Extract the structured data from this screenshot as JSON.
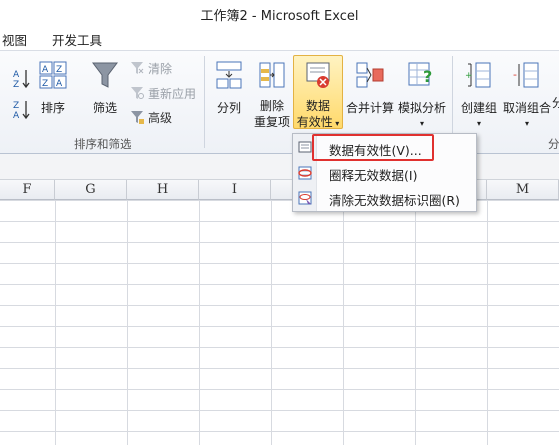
{
  "window": {
    "title": "工作簿2  -  Microsoft Excel"
  },
  "tabs": [
    {
      "label": "视图"
    },
    {
      "label": "开发工具"
    }
  ],
  "ribbon": {
    "sort_filter_group": {
      "label": "排序和筛选",
      "sort_asc_icon": "sort-ascending-icon",
      "sort_desc_icon": "sort-descending-icon",
      "sort_label": "排序",
      "filter_label": "筛选",
      "clear_label": "清除",
      "reapply_label": "重新应用",
      "advanced_label": "高级"
    },
    "data_tools": {
      "split_label": "分列",
      "remove_dup_line1": "删除",
      "remove_dup_line2": "重复项",
      "validation_line1": "数据",
      "validation_line2": "有效性",
      "consolidate_label": "合并计算",
      "whatif_label": "模拟分析"
    },
    "outline": {
      "group_label": "创建组",
      "ungroup_label": "取消组合",
      "partial_label": "分",
      "partial_group_label": "分"
    }
  },
  "columns": [
    "F",
    "G",
    "H",
    "I",
    "M"
  ],
  "validation_menu": {
    "items": [
      {
        "label": "数据有效性(V)...",
        "icon": "data-validation-icon"
      },
      {
        "label": "圈释无效数据(I)",
        "icon": "circle-invalid-icon"
      },
      {
        "label": "清除无效数据标识圈(R)",
        "icon": "clear-circles-icon"
      }
    ]
  },
  "colors": {
    "highlight_border": "#e0312f",
    "active_button": "#ffd96b",
    "ribbon_bg": "#eef1f6"
  }
}
